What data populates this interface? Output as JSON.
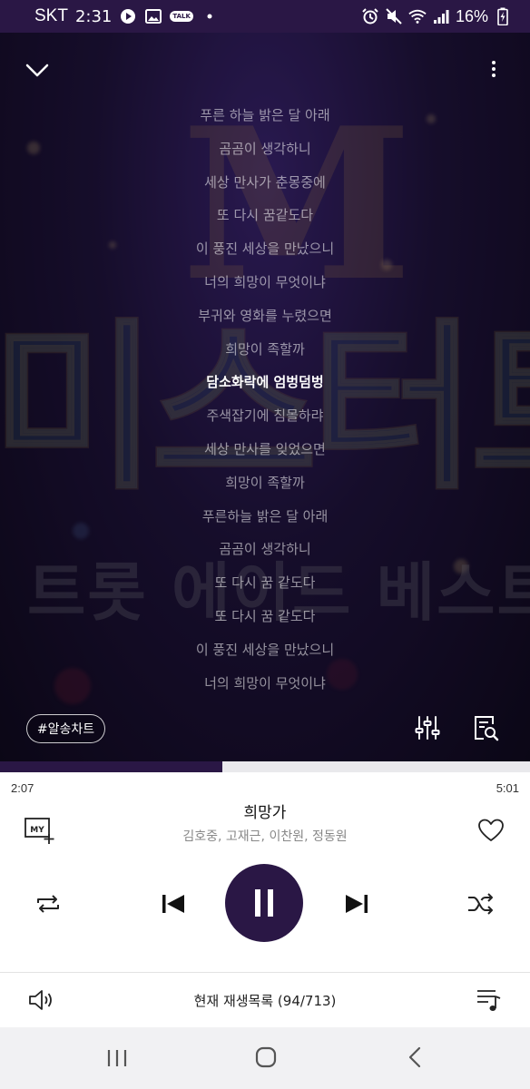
{
  "status_bar": {
    "carrier": "SKT",
    "time": "2:31",
    "battery": "16%",
    "talk_badge": "TALK"
  },
  "artwork": {
    "title_text": "미스터트롯",
    "subtitle_text": "트롯 에이드 베스트",
    "logo_text": "M"
  },
  "lyrics": [
    {
      "text": "푸른 하늘 밝은 달 아래"
    },
    {
      "text": "곰곰이 생각하니"
    },
    {
      "text": "세상 만사가 춘몽중에"
    },
    {
      "text": "또 다시 꿈같도다"
    },
    {
      "text": "이 풍진 세상을 만났으니"
    },
    {
      "text": "너의 희망이 무엇이냐"
    },
    {
      "text": "부귀와 영화를 누렸으면"
    },
    {
      "text": "희망이 족할까"
    },
    {
      "text": "담소화락에 엄벙덤벙"
    },
    {
      "text": "주색잡기에 침몰하랴"
    },
    {
      "text": "세상 만사를 잊었으면"
    },
    {
      "text": "희망이 족할까"
    },
    {
      "text": "푸른하늘 밝은 달 아래"
    },
    {
      "text": "곰곰이 생각하니"
    },
    {
      "text": "또 다시 꿈 같도다"
    },
    {
      "text": "또 다시 꿈 같도다"
    },
    {
      "text": "이 풍진 세상을 만났으니"
    },
    {
      "text": "너의 희망이 무엇이냐"
    }
  ],
  "active_lyric_index": 8,
  "tag_chip": "#알송차트",
  "player": {
    "current_time": "2:07",
    "total_time": "5:01",
    "progress_fraction": 0.42,
    "song_title": "희망가",
    "artists": "김호중, 고재근, 이찬원, 정동원",
    "my_label": "MY",
    "playlist_label": "현재 재생목록 (94/713)"
  },
  "colors": {
    "accent": "#2a1745",
    "progress_track": "#e9e9ec",
    "nav_bg": "#f1f1f3"
  },
  "icons": {
    "collapse": "chevron-down-icon",
    "more": "more-vertical-icon",
    "equalizer": "equalizer-icon",
    "lyric_search": "lyric-search-icon",
    "my_add": "add-to-my-list-icon",
    "like": "heart-icon",
    "repeat": "repeat-icon",
    "prev": "skip-previous-icon",
    "pause": "pause-icon",
    "next": "skip-next-icon",
    "shuffle": "shuffle-icon",
    "volume": "volume-icon",
    "queue": "queue-music-icon"
  }
}
